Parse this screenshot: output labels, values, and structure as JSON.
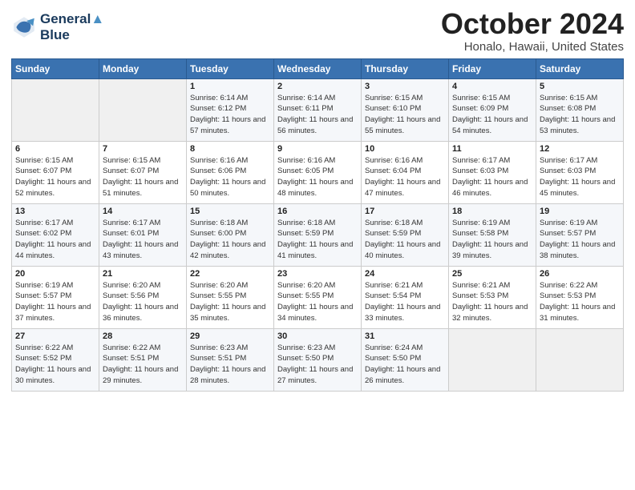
{
  "header": {
    "logo_line1": "General",
    "logo_line2": "Blue",
    "title": "October 2024",
    "location": "Honalo, Hawaii, United States"
  },
  "days_of_week": [
    "Sunday",
    "Monday",
    "Tuesday",
    "Wednesday",
    "Thursday",
    "Friday",
    "Saturday"
  ],
  "weeks": [
    [
      {
        "day": "",
        "info": ""
      },
      {
        "day": "",
        "info": ""
      },
      {
        "day": "1",
        "info": "Sunrise: 6:14 AM\nSunset: 6:12 PM\nDaylight: 11 hours and 57 minutes."
      },
      {
        "day": "2",
        "info": "Sunrise: 6:14 AM\nSunset: 6:11 PM\nDaylight: 11 hours and 56 minutes."
      },
      {
        "day": "3",
        "info": "Sunrise: 6:15 AM\nSunset: 6:10 PM\nDaylight: 11 hours and 55 minutes."
      },
      {
        "day": "4",
        "info": "Sunrise: 6:15 AM\nSunset: 6:09 PM\nDaylight: 11 hours and 54 minutes."
      },
      {
        "day": "5",
        "info": "Sunrise: 6:15 AM\nSunset: 6:08 PM\nDaylight: 11 hours and 53 minutes."
      }
    ],
    [
      {
        "day": "6",
        "info": "Sunrise: 6:15 AM\nSunset: 6:07 PM\nDaylight: 11 hours and 52 minutes."
      },
      {
        "day": "7",
        "info": "Sunrise: 6:15 AM\nSunset: 6:07 PM\nDaylight: 11 hours and 51 minutes."
      },
      {
        "day": "8",
        "info": "Sunrise: 6:16 AM\nSunset: 6:06 PM\nDaylight: 11 hours and 50 minutes."
      },
      {
        "day": "9",
        "info": "Sunrise: 6:16 AM\nSunset: 6:05 PM\nDaylight: 11 hours and 48 minutes."
      },
      {
        "day": "10",
        "info": "Sunrise: 6:16 AM\nSunset: 6:04 PM\nDaylight: 11 hours and 47 minutes."
      },
      {
        "day": "11",
        "info": "Sunrise: 6:17 AM\nSunset: 6:03 PM\nDaylight: 11 hours and 46 minutes."
      },
      {
        "day": "12",
        "info": "Sunrise: 6:17 AM\nSunset: 6:03 PM\nDaylight: 11 hours and 45 minutes."
      }
    ],
    [
      {
        "day": "13",
        "info": "Sunrise: 6:17 AM\nSunset: 6:02 PM\nDaylight: 11 hours and 44 minutes."
      },
      {
        "day": "14",
        "info": "Sunrise: 6:17 AM\nSunset: 6:01 PM\nDaylight: 11 hours and 43 minutes."
      },
      {
        "day": "15",
        "info": "Sunrise: 6:18 AM\nSunset: 6:00 PM\nDaylight: 11 hours and 42 minutes."
      },
      {
        "day": "16",
        "info": "Sunrise: 6:18 AM\nSunset: 5:59 PM\nDaylight: 11 hours and 41 minutes."
      },
      {
        "day": "17",
        "info": "Sunrise: 6:18 AM\nSunset: 5:59 PM\nDaylight: 11 hours and 40 minutes."
      },
      {
        "day": "18",
        "info": "Sunrise: 6:19 AM\nSunset: 5:58 PM\nDaylight: 11 hours and 39 minutes."
      },
      {
        "day": "19",
        "info": "Sunrise: 6:19 AM\nSunset: 5:57 PM\nDaylight: 11 hours and 38 minutes."
      }
    ],
    [
      {
        "day": "20",
        "info": "Sunrise: 6:19 AM\nSunset: 5:57 PM\nDaylight: 11 hours and 37 minutes."
      },
      {
        "day": "21",
        "info": "Sunrise: 6:20 AM\nSunset: 5:56 PM\nDaylight: 11 hours and 36 minutes."
      },
      {
        "day": "22",
        "info": "Sunrise: 6:20 AM\nSunset: 5:55 PM\nDaylight: 11 hours and 35 minutes."
      },
      {
        "day": "23",
        "info": "Sunrise: 6:20 AM\nSunset: 5:55 PM\nDaylight: 11 hours and 34 minutes."
      },
      {
        "day": "24",
        "info": "Sunrise: 6:21 AM\nSunset: 5:54 PM\nDaylight: 11 hours and 33 minutes."
      },
      {
        "day": "25",
        "info": "Sunrise: 6:21 AM\nSunset: 5:53 PM\nDaylight: 11 hours and 32 minutes."
      },
      {
        "day": "26",
        "info": "Sunrise: 6:22 AM\nSunset: 5:53 PM\nDaylight: 11 hours and 31 minutes."
      }
    ],
    [
      {
        "day": "27",
        "info": "Sunrise: 6:22 AM\nSunset: 5:52 PM\nDaylight: 11 hours and 30 minutes."
      },
      {
        "day": "28",
        "info": "Sunrise: 6:22 AM\nSunset: 5:51 PM\nDaylight: 11 hours and 29 minutes."
      },
      {
        "day": "29",
        "info": "Sunrise: 6:23 AM\nSunset: 5:51 PM\nDaylight: 11 hours and 28 minutes."
      },
      {
        "day": "30",
        "info": "Sunrise: 6:23 AM\nSunset: 5:50 PM\nDaylight: 11 hours and 27 minutes."
      },
      {
        "day": "31",
        "info": "Sunrise: 6:24 AM\nSunset: 5:50 PM\nDaylight: 11 hours and 26 minutes."
      },
      {
        "day": "",
        "info": ""
      },
      {
        "day": "",
        "info": ""
      }
    ]
  ]
}
